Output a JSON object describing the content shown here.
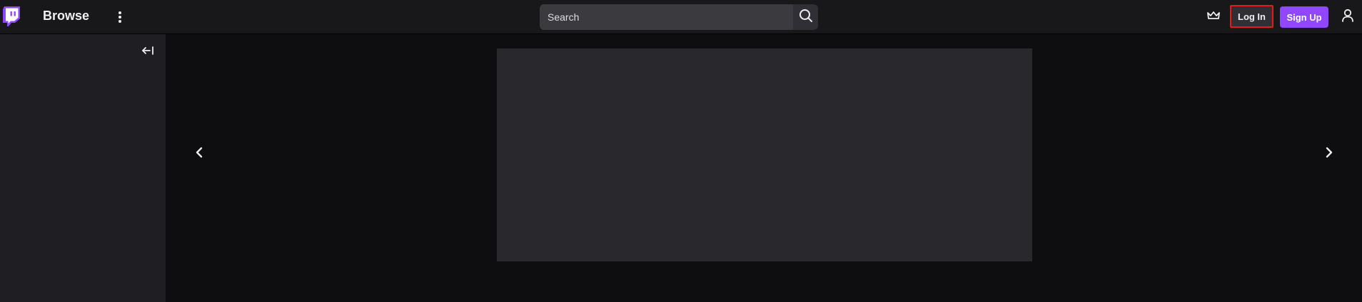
{
  "topnav": {
    "browse_label": "Browse",
    "search": {
      "placeholder": "Search"
    },
    "login_label": "Log In",
    "signup_label": "Sign Up"
  },
  "icons": {
    "logo": "twitch-logo-icon",
    "more": "vertical-ellipsis-icon",
    "search": "search-icon",
    "prime": "crown-icon",
    "user": "user-icon",
    "collapse": "collapse-left-icon",
    "prev": "chevron-left-icon",
    "next": "chevron-right-icon"
  },
  "colors": {
    "brand_purple": "#9147ff",
    "login_outline": "#e91916",
    "nav_background": "#18181b",
    "sidebar_background": "#1f1f23",
    "page_background": "#0e0e10",
    "placeholder_card": "#28282d"
  }
}
